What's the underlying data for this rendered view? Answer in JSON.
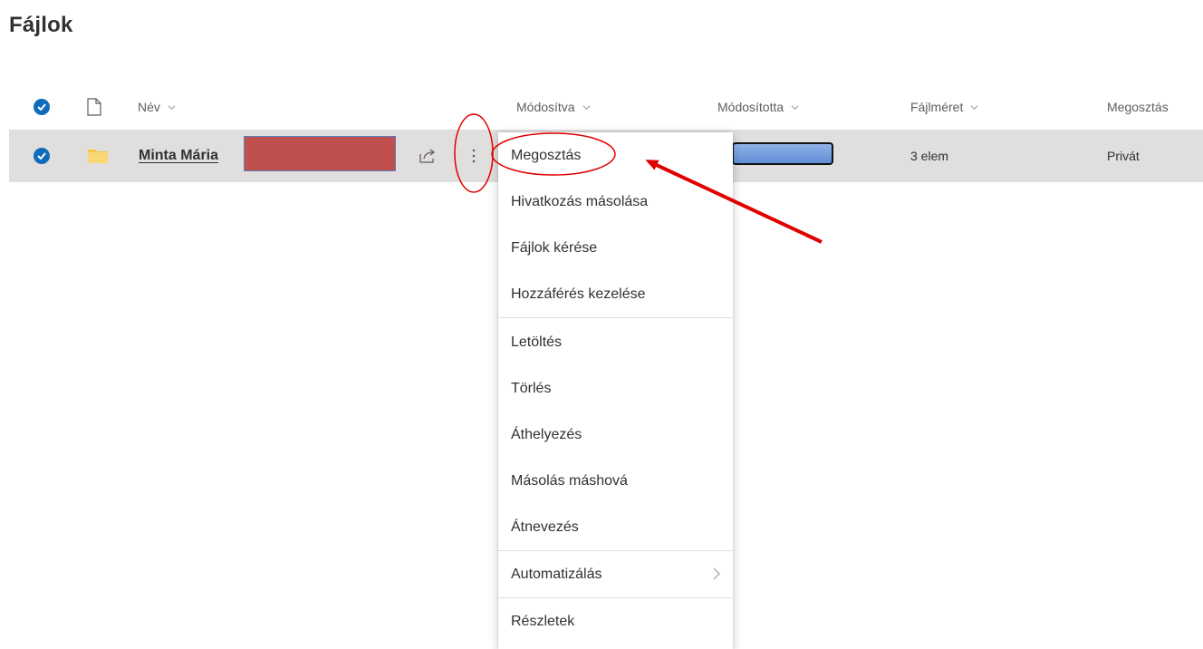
{
  "page": {
    "title": "Fájlok"
  },
  "columns": {
    "name": "Név",
    "modified": "Módosítva",
    "modified_by": "Módosította",
    "file_size": "Fájlméret",
    "sharing": "Megosztás"
  },
  "row": {
    "name": "Minta Mária",
    "file_size": "3 elem",
    "sharing": "Privát"
  },
  "context_menu": {
    "items": [
      {
        "label": "Megosztás"
      },
      {
        "label": "Hivatkozás másolása"
      },
      {
        "label": "Fájlok kérése"
      },
      {
        "label": "Hozzáférés kezelése"
      },
      {
        "label": "Letöltés"
      },
      {
        "label": "Törlés"
      },
      {
        "label": "Áthelyezés"
      },
      {
        "label": "Másolás máshová"
      },
      {
        "label": "Átnevezés"
      },
      {
        "label": "Automatizálás"
      },
      {
        "label": "Részletek"
      }
    ]
  },
  "icons": {
    "select_all": "check-circle-icon",
    "file_type": "document-icon",
    "row_select": "check-circle-icon",
    "folder": "folder-icon",
    "share": "share-icon",
    "more": "more-vertical-icon",
    "submenu": "chevron-right-icon"
  },
  "colors": {
    "accent": "#0f6cbd",
    "selected_row": "#e1dfdd",
    "folder": "#f4c542",
    "annotation": "#e00000"
  }
}
